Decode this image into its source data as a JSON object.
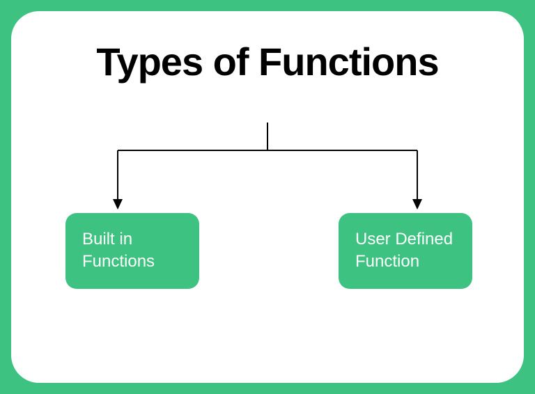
{
  "title": "Types of Functions",
  "left_box": "Built in Functions",
  "right_box": "User Defined Function",
  "colors": {
    "accent": "#3ec281",
    "bg": "#ffffff",
    "text_dark": "#000000",
    "text_light": "#ffffff"
  }
}
